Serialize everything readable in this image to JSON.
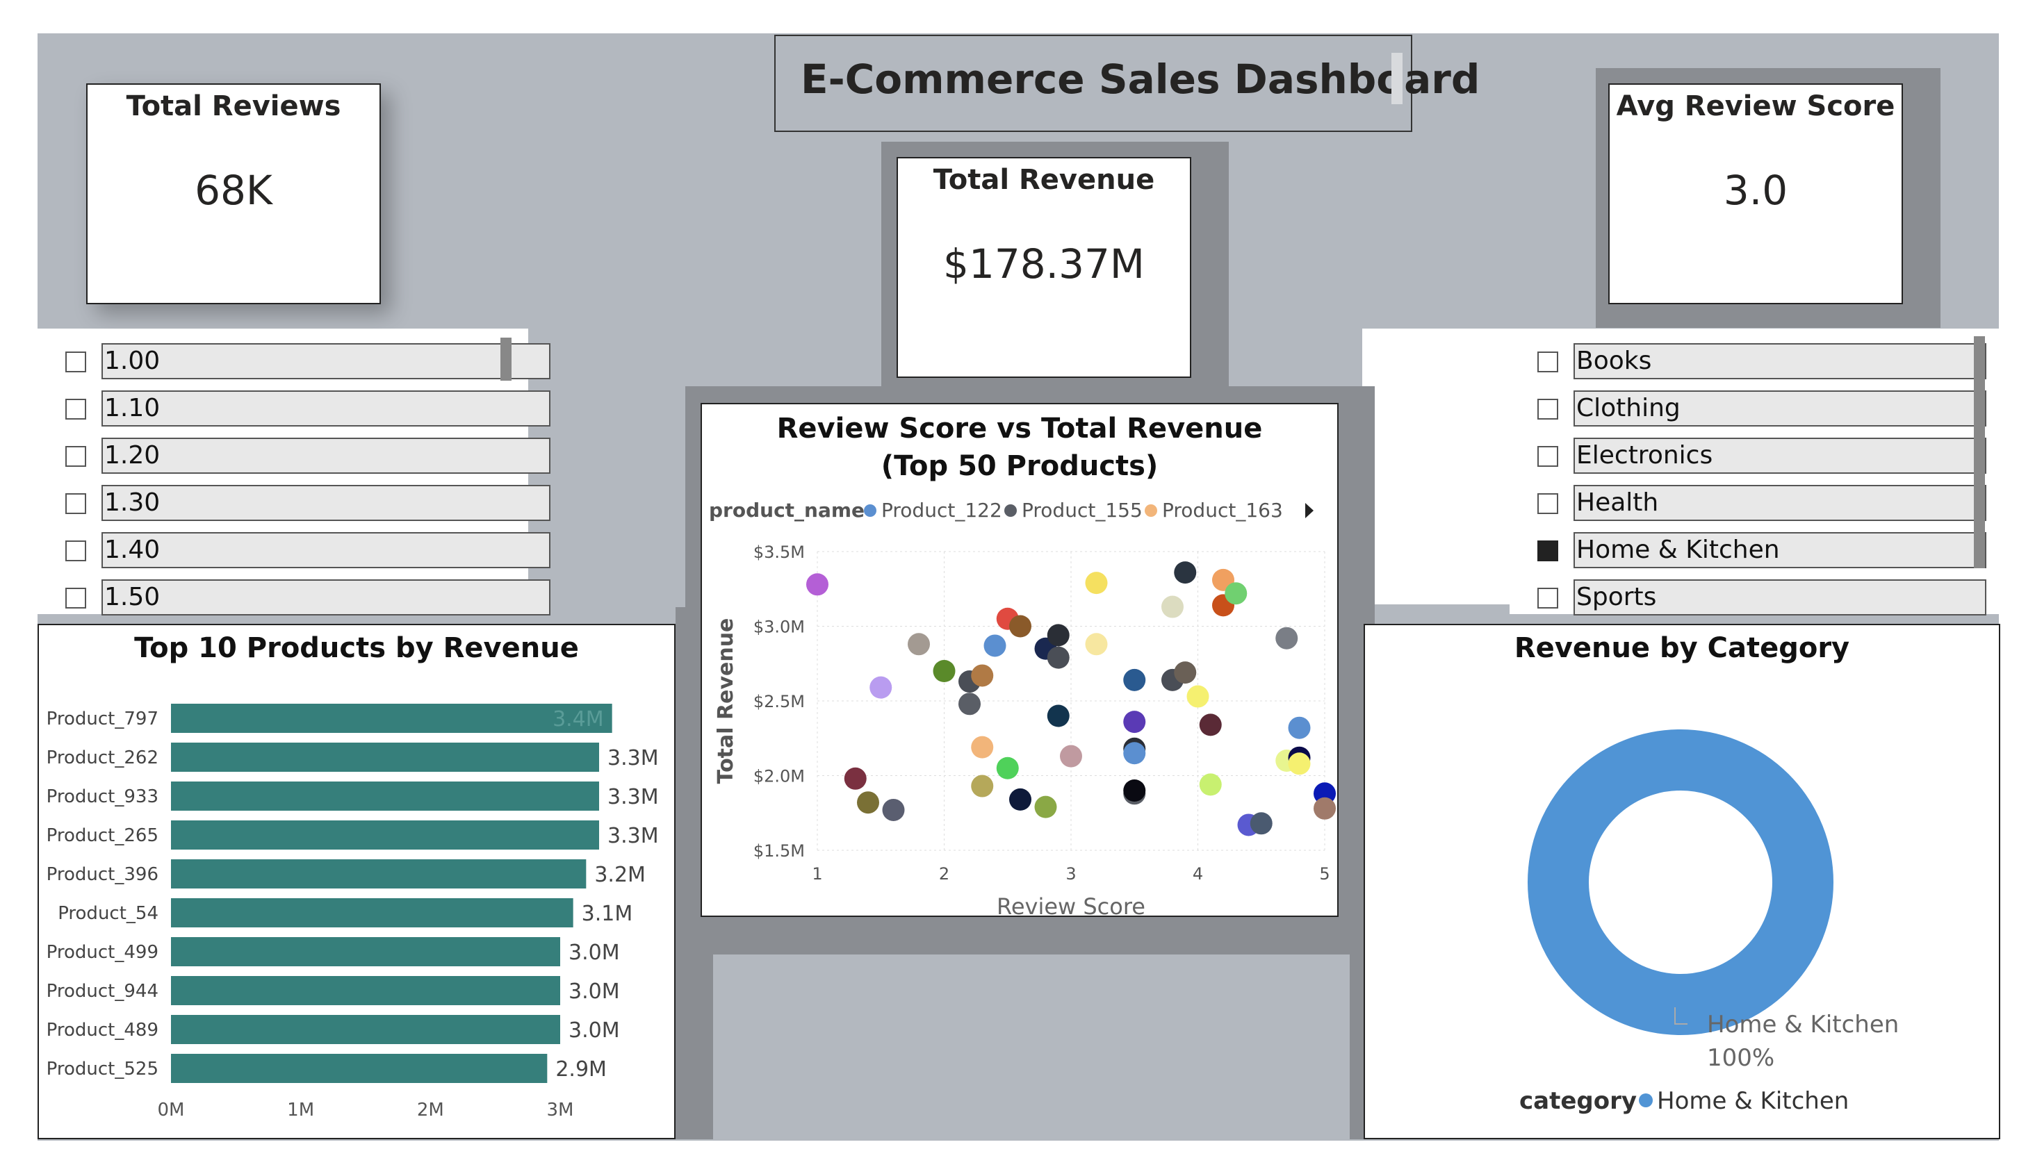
{
  "dashboard_title": "E-Commerce Sales Dashboard",
  "cards": {
    "total_reviews": {
      "title": "Total Reviews",
      "value": "68K"
    },
    "total_revenue": {
      "title": "Total Revenue",
      "value": "$178.37M"
    },
    "avg_review_score": {
      "title": "Avg Review Score",
      "value": "3.0"
    }
  },
  "score_slicer": {
    "items": [
      {
        "label": "1.00",
        "checked": false
      },
      {
        "label": "1.10",
        "checked": false
      },
      {
        "label": "1.20",
        "checked": false
      },
      {
        "label": "1.30",
        "checked": false
      },
      {
        "label": "1.40",
        "checked": false
      },
      {
        "label": "1.50",
        "checked": false
      }
    ]
  },
  "category_slicer": {
    "items": [
      {
        "label": "Books",
        "checked": false
      },
      {
        "label": "Clothing",
        "checked": false
      },
      {
        "label": "Electronics",
        "checked": false
      },
      {
        "label": "Health",
        "checked": false
      },
      {
        "label": "Home & Kitchen",
        "checked": true
      },
      {
        "label": "Sports",
        "checked": false
      }
    ]
  },
  "colors": {
    "background_gray": "#b3b8bf",
    "bar": "#367f7b",
    "donut": "#5094d5",
    "panel_dark": "#8a8d92"
  },
  "chart_data": [
    {
      "type": "bar",
      "orientation": "horizontal",
      "title": "Top 10 Products by Revenue",
      "categories": [
        "Product_797",
        "Product_262",
        "Product_933",
        "Product_265",
        "Product_396",
        "Product_54",
        "Product_499",
        "Product_944",
        "Product_489",
        "Product_525"
      ],
      "values": [
        3.4,
        3.3,
        3.3,
        3.3,
        3.2,
        3.1,
        3.0,
        3.0,
        3.0,
        2.9
      ],
      "value_labels": [
        "3.4M",
        "3.3M",
        "3.3M",
        "3.3M",
        "3.2M",
        "3.1M",
        "3.0M",
        "3.0M",
        "3.0M",
        "2.9M"
      ],
      "x_ticks": [
        "0M",
        "1M",
        "2M",
        "3M"
      ],
      "xlim": [
        0,
        3.75
      ],
      "unit": "M",
      "color": "#367f7b"
    },
    {
      "type": "scatter",
      "title": "Review Score vs Total Revenue (Top 50 Products)",
      "legend_title": "product_name",
      "legend": [
        {
          "name": "Product_122",
          "color": "#5b8fd0"
        },
        {
          "name": "Product_155",
          "color": "#5a5e66"
        },
        {
          "name": "Product_163",
          "color": "#f2b57a"
        }
      ],
      "xlabel": "Review Score",
      "ylabel": "Total Revenue",
      "xlim": [
        1,
        5
      ],
      "ylim": [
        1.5,
        3.5
      ],
      "x_ticks": [
        "1",
        "2",
        "3",
        "4",
        "5"
      ],
      "y_ticks": [
        "$1.5M",
        "$2.0M",
        "$2.5M",
        "$3.0M",
        "$3.5M"
      ],
      "points": [
        {
          "x": 1.0,
          "y": 3.28,
          "color": "#b45fd6"
        },
        {
          "x": 1.3,
          "y": 1.98,
          "color": "#7a3040"
        },
        {
          "x": 1.4,
          "y": 1.82,
          "color": "#7a7035"
        },
        {
          "x": 1.5,
          "y": 2.59,
          "color": "#b99cf0"
        },
        {
          "x": 1.6,
          "y": 1.77,
          "color": "#5a5e70"
        },
        {
          "x": 1.8,
          "y": 2.88,
          "color": "#a39a92"
        },
        {
          "x": 2.0,
          "y": 2.7,
          "color": "#5a8a2a"
        },
        {
          "x": 2.2,
          "y": 2.48,
          "color": "#5a5e66"
        },
        {
          "x": 2.2,
          "y": 2.63,
          "color": "#4a4e56"
        },
        {
          "x": 2.3,
          "y": 2.67,
          "color": "#b07a45"
        },
        {
          "x": 2.3,
          "y": 2.19,
          "color": "#f2b57a"
        },
        {
          "x": 2.3,
          "y": 1.93,
          "color": "#b5a85a"
        },
        {
          "x": 2.4,
          "y": 2.87,
          "color": "#5b8fd0"
        },
        {
          "x": 2.5,
          "y": 3.05,
          "color": "#e04a40"
        },
        {
          "x": 2.5,
          "y": 2.05,
          "color": "#4fd15a"
        },
        {
          "x": 2.6,
          "y": 3.0,
          "color": "#8a5a2a"
        },
        {
          "x": 2.6,
          "y": 1.84,
          "color": "#0e1a3a"
        },
        {
          "x": 2.8,
          "y": 2.85,
          "color": "#1a2850"
        },
        {
          "x": 2.8,
          "y": 1.79,
          "color": "#8aa845"
        },
        {
          "x": 2.9,
          "y": 2.94,
          "color": "#2a2e36"
        },
        {
          "x": 2.9,
          "y": 2.79,
          "color": "#4a4e56"
        },
        {
          "x": 2.9,
          "y": 2.4,
          "color": "#12344e"
        },
        {
          "x": 3.0,
          "y": 2.13,
          "color": "#c09aa0"
        },
        {
          "x": 3.2,
          "y": 3.29,
          "color": "#f5e060"
        },
        {
          "x": 3.2,
          "y": 2.88,
          "color": "#f7e7a0"
        },
        {
          "x": 3.5,
          "y": 2.64,
          "color": "#2a5a90"
        },
        {
          "x": 3.5,
          "y": 2.36,
          "color": "#5a3ab5"
        },
        {
          "x": 3.5,
          "y": 2.18,
          "color": "#2a2e36"
        },
        {
          "x": 3.5,
          "y": 1.88,
          "color": "#5a5e66"
        },
        {
          "x": 3.5,
          "y": 1.9,
          "color": "#0a0a12"
        },
        {
          "x": 3.5,
          "y": 2.15,
          "color": "#5b8fd0"
        },
        {
          "x": 3.8,
          "y": 2.64,
          "color": "#4a4e56"
        },
        {
          "x": 3.8,
          "y": 3.13,
          "color": "#dcdcc0"
        },
        {
          "x": 3.9,
          "y": 3.36,
          "color": "#2a3440"
        },
        {
          "x": 3.9,
          "y": 2.69,
          "color": "#6a6056"
        },
        {
          "x": 4.0,
          "y": 2.53,
          "color": "#f5f070"
        },
        {
          "x": 4.1,
          "y": 2.34,
          "color": "#5a2a36"
        },
        {
          "x": 4.1,
          "y": 1.94,
          "color": "#c8f070"
        },
        {
          "x": 4.2,
          "y": 3.31,
          "color": "#f0a060"
        },
        {
          "x": 4.2,
          "y": 3.14,
          "color": "#c8501a"
        },
        {
          "x": 4.3,
          "y": 3.22,
          "color": "#70d070"
        },
        {
          "x": 4.4,
          "y": 1.67,
          "color": "#5a5ad0"
        },
        {
          "x": 4.5,
          "y": 1.68,
          "color": "#4a5a70"
        },
        {
          "x": 4.7,
          "y": 2.92,
          "color": "#7a7e86"
        },
        {
          "x": 4.7,
          "y": 2.1,
          "color": "#e8f590"
        },
        {
          "x": 4.8,
          "y": 2.32,
          "color": "#5b8fd0"
        },
        {
          "x": 4.8,
          "y": 2.12,
          "color": "#0a0a4a"
        },
        {
          "x": 4.8,
          "y": 2.08,
          "color": "#f5f070"
        },
        {
          "x": 5.0,
          "y": 1.88,
          "color": "#0a1ab5"
        },
        {
          "x": 5.0,
          "y": 1.78,
          "color": "#a07a6a"
        }
      ]
    },
    {
      "type": "pie",
      "subtype": "donut",
      "title": "Revenue by Category",
      "legend_title": "category",
      "slices": [
        {
          "label": "Home & Kitchen",
          "value": 100,
          "percent_label": "100%",
          "color": "#5094d5"
        }
      ]
    }
  ]
}
